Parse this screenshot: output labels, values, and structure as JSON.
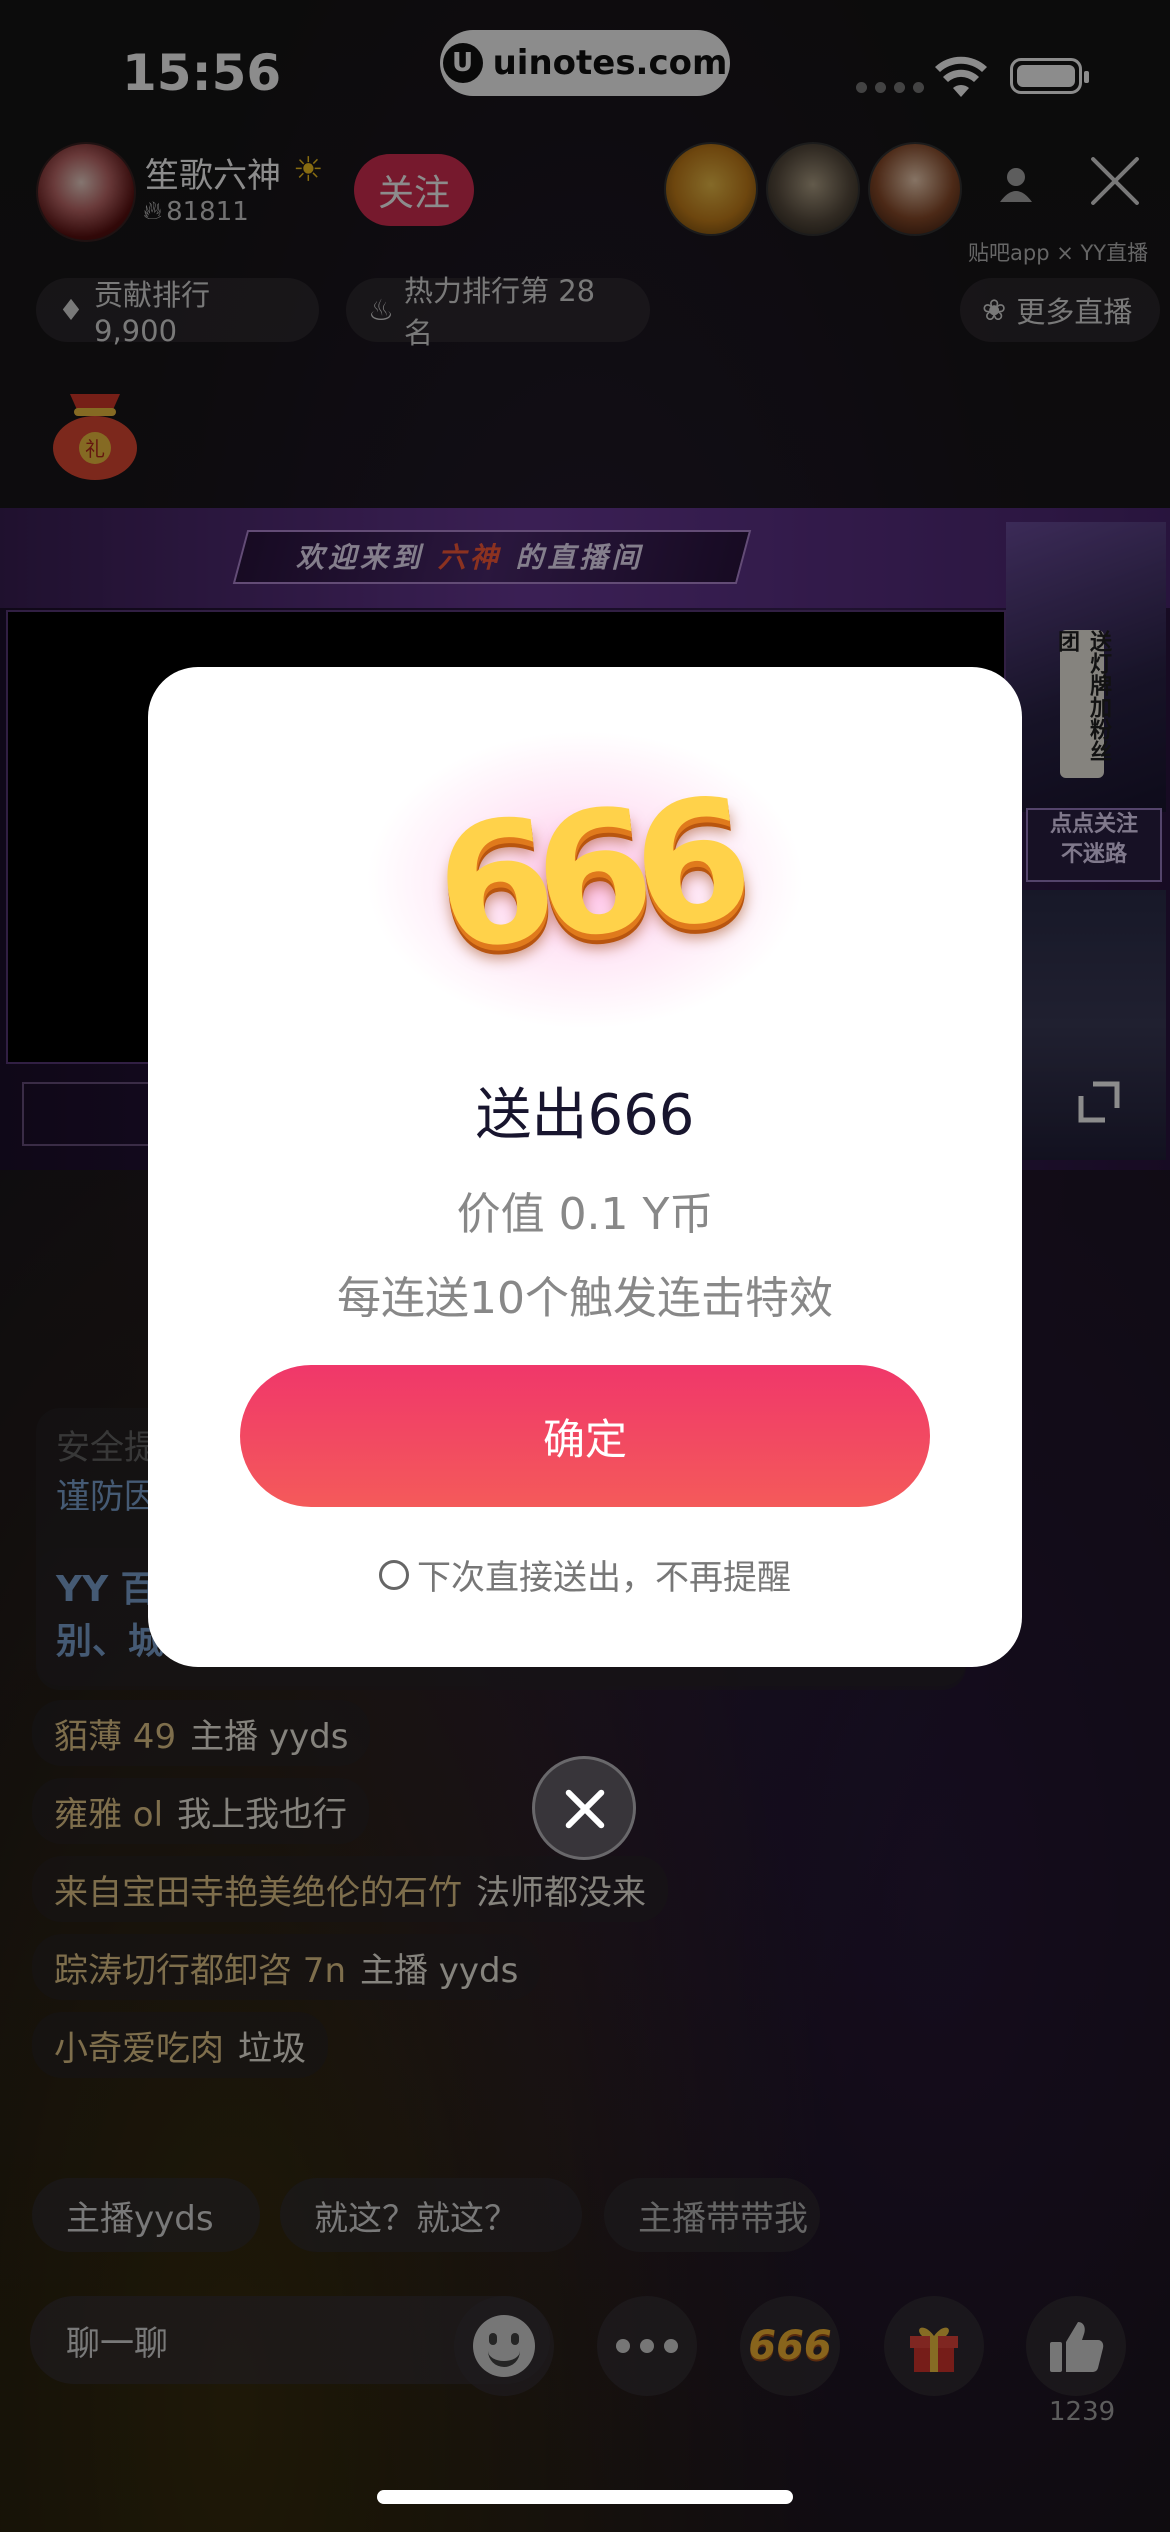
{
  "status_bar": {
    "time": "15:56",
    "url": "uinotes.com",
    "url_logo": "U"
  },
  "header": {
    "streamer_name": "笙歌六神",
    "heat_value": "81811",
    "follow_label": "关注",
    "partner_text": "贴吧app × YY直播"
  },
  "ranks": {
    "contribution": "贡献排行 9,900",
    "hot": "热力排行第 28 名",
    "more_live": "更多直播"
  },
  "stream": {
    "welcome_prefix": "欢迎来到",
    "welcome_name": "六神",
    "welcome_suffix": "的直播间",
    "side_badge": "送灯牌加粉丝团",
    "follow_tip_line1": "点点关注",
    "follow_tip_line2": "不迷路"
  },
  "chat": {
    "notice_1a": "安全提",
    "notice_1b": "谨防因",
    "notice_2a": "YY 百",
    "notice_2b": "别、城",
    "messages": [
      {
        "user": "貊薄 49",
        "msg": "主播 yyds"
      },
      {
        "user": "雍雅 ol",
        "msg": "我上我也行"
      },
      {
        "user": "来自宝田寺艳美绝伦的石竹",
        "msg": "法师都没来"
      },
      {
        "user": "踪涛切行都卸咨 7n",
        "msg": "主播 yyds"
      },
      {
        "user": "小奇爱吃肉",
        "msg": "垃圾"
      }
    ]
  },
  "quick_replies": [
    "主播yyds",
    "就这？就这？",
    "主播带带我"
  ],
  "bottom_bar": {
    "input_placeholder": "聊一聊",
    "gift_666_label": "666",
    "like_count": "1239"
  },
  "modal": {
    "gift_art": "666",
    "title": "送出666",
    "value": "价值 0.1 Y币",
    "effect": "每连送10个触发连击特效",
    "confirm": "确定",
    "remember": "下次直接送出，不再提醒"
  }
}
